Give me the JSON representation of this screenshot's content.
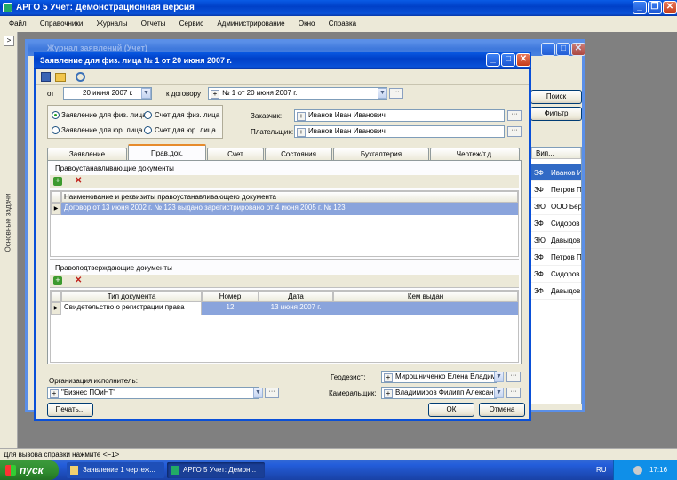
{
  "app": {
    "title": "АРГО 5 Учет: Демонстрационная версия"
  },
  "menu": [
    "Файл",
    "Справочники",
    "Журналы",
    "Отчеты",
    "Сервис",
    "Администрирование",
    "Окно",
    "Справка"
  ],
  "side_panel": {
    "label": "Основные задачи",
    "arrow": ">"
  },
  "bg_window": {
    "title": "Журнал заявлений (Учет)",
    "search_button": "Поиск",
    "filter_button": "Фильтр",
    "col_header": "Вип...",
    "rows": [
      {
        "type": "ЗФ",
        "name": "Иванов И"
      },
      {
        "type": "ЗФ",
        "name": "Петров П"
      },
      {
        "type": "ЗЮ",
        "name": "ООО Бере"
      },
      {
        "type": "ЗФ",
        "name": "Сидоров"
      },
      {
        "type": "ЗЮ",
        "name": "Давыдов"
      },
      {
        "type": "ЗФ",
        "name": "Петров П"
      },
      {
        "type": "ЗФ",
        "name": "Сидоров"
      },
      {
        "type": "ЗФ",
        "name": "Давыдов"
      }
    ]
  },
  "dialog": {
    "title": "Заявление для физ. лица № 1 от 20 июня 2007 г.",
    "from_label": "от",
    "date_value": "20 июня 2007 г.",
    "contract_label": "к договору",
    "contract_value": "№ 1 от 20 июня 2007 г.",
    "radios": {
      "phys_app": "Заявление для физ. лица",
      "phys_acc": "Счет для физ. лица",
      "jur_app": "Заявление для юр. лица",
      "jur_acc": "Счет для юр. лица"
    },
    "customer_label": "Заказчик:",
    "customer_value": "Иванов Иван Иванович",
    "payer_label": "Плательщик:",
    "payer_value": "Иванов Иван Иванович",
    "tabs": [
      "Заявление",
      "Прав.док.",
      "Счет",
      "Состояния",
      "Бухгалтерия",
      "Чертеж/т.д."
    ],
    "section1": {
      "title": "Правоустанавливающие документы",
      "col": "Наименование и реквизиты правоустанавливающего документа",
      "row": "Договор  от 13 июня 2002 г. № 123 выдано  зарегистрировано  от 4 июня 2005 г. № 123"
    },
    "section2": {
      "title": "Правоподтверждающие документы",
      "cols": [
        "Тип документа",
        "Номер",
        "Дата",
        "Кем выдан"
      ],
      "row": {
        "type": "Свидетельство о регистрации права",
        "number": "12",
        "date": "13 июня 2007 г.",
        "issuer": ""
      }
    },
    "org_label": "Организация исполнитель:",
    "org_value": "\"Бизнес ПОиНТ\"",
    "geodesist_label": "Геодезист:",
    "geodesist_value": "Мирошниченко Елена Владими",
    "cameral_label": "Камеральщик:",
    "cameral_value": "Владимиров Филипп Алексан",
    "print_button": "Печать...",
    "ok_button": "ОК",
    "cancel_button": "Отмена"
  },
  "status_bar": "Для вызова справки нажмите <F1>",
  "taskbar": {
    "start": "пуск",
    "task1": "Заявление 1 чертеж...",
    "task2": "АРГО 5 Учет: Демон...",
    "lang": "RU",
    "clock": "17:16"
  }
}
